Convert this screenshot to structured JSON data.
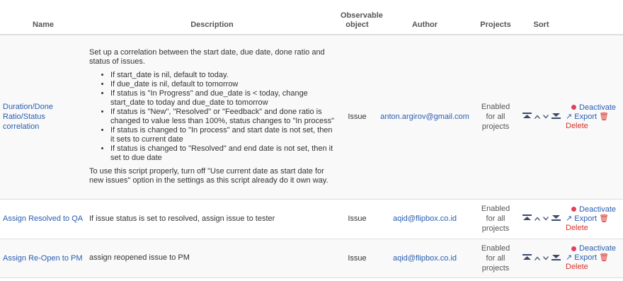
{
  "headers": {
    "name": "Name",
    "description": "Description",
    "observable_line1": "Observable",
    "observable_line2": "object",
    "author": "Author",
    "projects": "Projects",
    "sort": "Sort"
  },
  "rows": [
    {
      "name": "Duration/Done Ratio/Status correlation",
      "description_intro": "Set up a correlation between the start date, due date, done ratio and status of issues.",
      "bullets": [
        "If start_date is nil, default to today.",
        "If due_date is nil, default to tomorrow",
        "If status is \"In Progress\" and due_date is < today, change start_date to today and due_date to tomorrow",
        "If status is \"New\", \"Resolved\" or \"Feedback\" and done ratio is changed to value less than 100%, status changes to \"In process\"",
        "If status is changed to \"In process\" and start date is not set, then it sets to current date",
        "If status is changed to \"Resolved\" and end date is not set, then it set to due date"
      ],
      "description_outro": "To use this script properly, turn off \"Use current date as start date for new issues\" option in the settings as this script already do it own way.",
      "observable": "Issue",
      "author": "anton.argirov@gmail.com",
      "projects": "Enabled for all projects"
    },
    {
      "name": "Assign Resolved to QA",
      "description_intro": "If issue status is set to resolved, assign issue to tester",
      "observable": "Issue",
      "author": "aqid@flipbox.co.id",
      "projects": "Enabled for all projects"
    },
    {
      "name": "Assign Re-Open to PM",
      "description_intro": "assign reopened issue to PM",
      "observable": "Issue",
      "author": "aqid@flipbox.co.id",
      "projects": "Enabled for all projects"
    }
  ],
  "actions": {
    "deactivate": "Deactivate",
    "export": "Export",
    "delete": "Delete"
  },
  "colors": {
    "link": "#2a5db0",
    "danger": "#d9302a",
    "sort_icon": "#3a4a6a"
  }
}
